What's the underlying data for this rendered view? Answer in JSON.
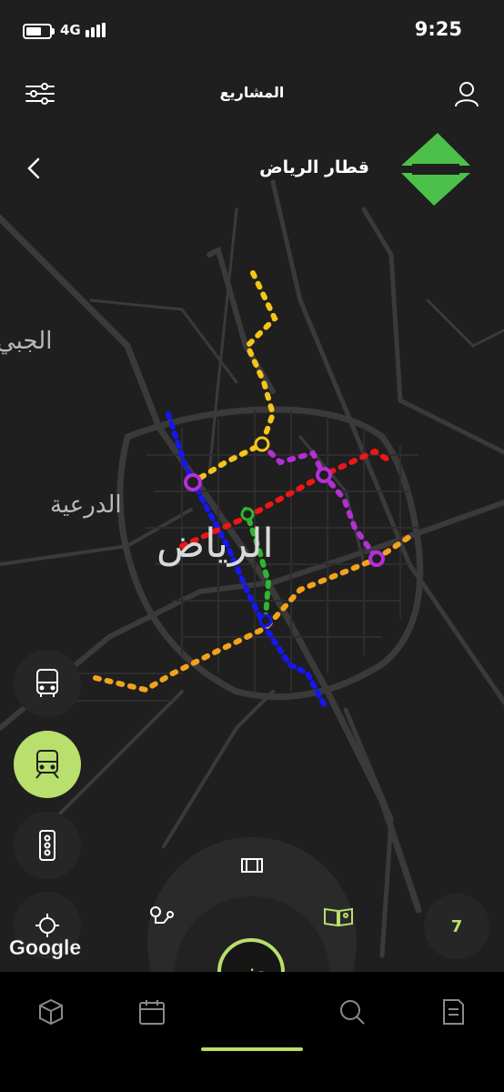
{
  "status_bar": {
    "time": "9:25",
    "network": "4G"
  },
  "header": {
    "title": "المشاريع"
  },
  "project": {
    "title": "قطار الرياض"
  },
  "map": {
    "labels": {
      "city": "الرياض",
      "diriyah": "الدرعية",
      "jubaila": "الجبي"
    },
    "line_colors": {
      "blue": "#1616f0",
      "red": "#ee1616",
      "yellow": "#f5c518",
      "purple": "#b52ed6",
      "orange": "#f4a21c",
      "green": "#2fb52f"
    },
    "attribution": "Google"
  },
  "side_buttons": [
    {
      "icon": "bus-icon",
      "active": false
    },
    {
      "icon": "train-icon",
      "active": true
    },
    {
      "icon": "traffic-light-icon",
      "active": false
    },
    {
      "icon": "locate-icon",
      "active": false
    }
  ],
  "dial": {
    "center_label": "ض",
    "icons": [
      "map-frame-icon",
      "route-icon",
      "map-book-icon"
    ]
  },
  "badge": {
    "count": "7"
  },
  "bottom_tabs": [
    "cube-icon",
    "calendar-icon",
    "search-icon",
    "document-icon"
  ],
  "colors": {
    "accent": "#b9df6c",
    "logo": "#4cc04a",
    "background": "#1f1f1f"
  }
}
